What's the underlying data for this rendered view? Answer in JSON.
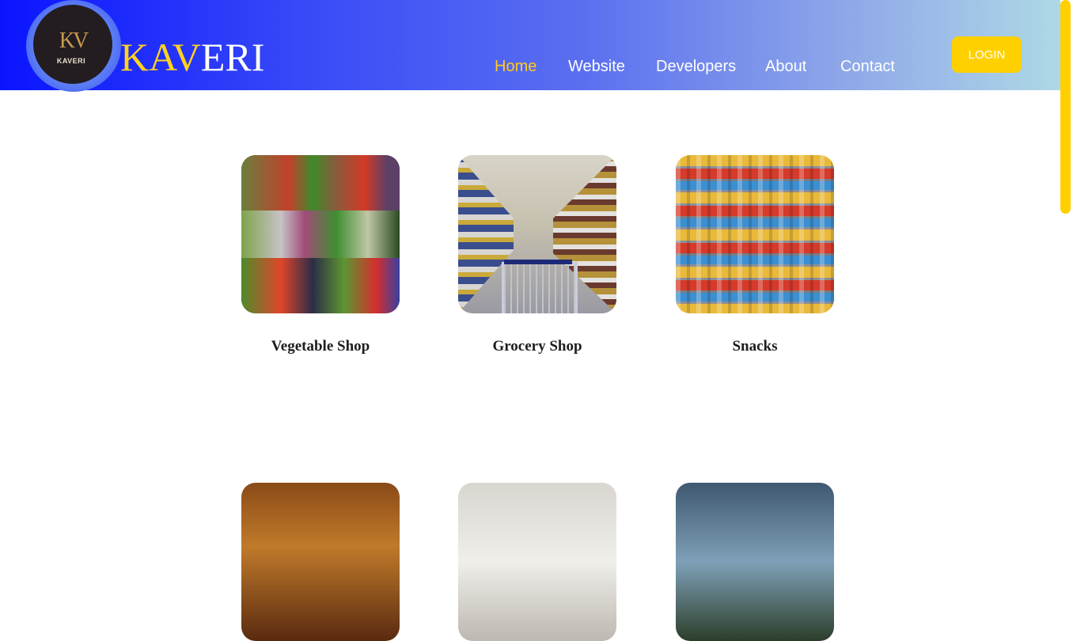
{
  "brand": {
    "first": "KAV",
    "second": "ERI",
    "logo_mark": "KV",
    "logo_sub": "KAVERI"
  },
  "nav": {
    "items": [
      "Home",
      "Website",
      "Developers",
      "About",
      "Contact"
    ],
    "active": "Home"
  },
  "login": {
    "label": "LOGIN"
  },
  "cards": [
    {
      "label": "Vegetable Shop",
      "image": "vegetable-market-image"
    },
    {
      "label": "Grocery Shop",
      "image": "grocery-aisle-image"
    },
    {
      "label": "Snacks",
      "image": "snacks-shelf-image"
    }
  ],
  "colors": {
    "accent": "#ffd000",
    "header_start": "#0a14ff",
    "header_end": "#aed8e6"
  }
}
